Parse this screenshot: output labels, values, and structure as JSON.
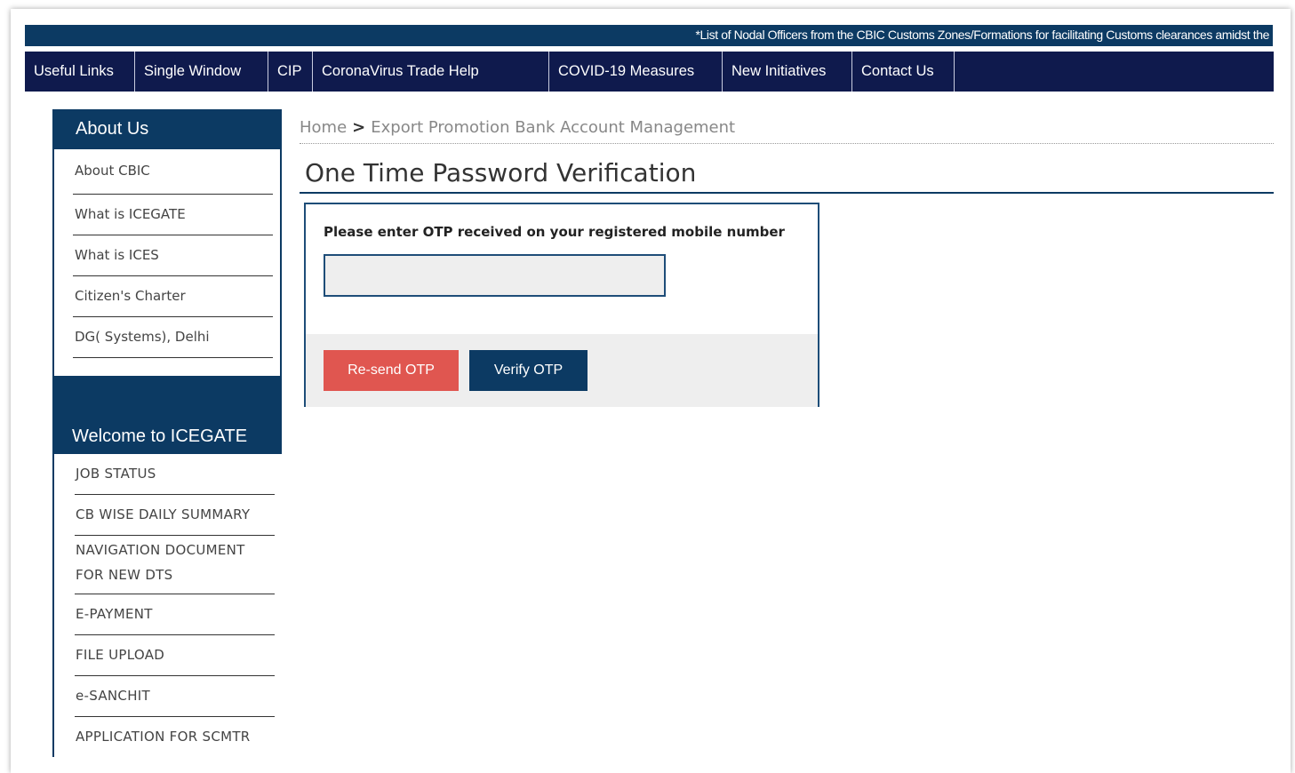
{
  "ticker": {
    "text": "*List of Nodal Officers from the CBIC Customs Zones/Formations for facilitating Customs clearances amidst the"
  },
  "menu": [
    {
      "label": "Useful Links"
    },
    {
      "label": "Single Window"
    },
    {
      "label": "CIP"
    },
    {
      "label": "CoronaVirus Trade Help"
    },
    {
      "label": "COVID-19 Measures"
    },
    {
      "label": "New Initiatives"
    },
    {
      "label": "Contact Us"
    }
  ],
  "about": {
    "title": "About Us",
    "items": [
      {
        "label": "About CBIC"
      },
      {
        "label": "What is ICEGATE"
      },
      {
        "label": "What is ICES"
      },
      {
        "label": "Citizen's Charter"
      },
      {
        "label": "DG( Systems), Delhi"
      }
    ]
  },
  "welcome": {
    "title": "Welcome to ICEGATE",
    "items": [
      {
        "label": "JOB STATUS"
      },
      {
        "label": "CB WISE DAILY SUMMARY"
      },
      {
        "label": "NAVIGATION DOCUMENT FOR NEW DTS"
      },
      {
        "label": "E-PAYMENT"
      },
      {
        "label": "FILE UPLOAD"
      },
      {
        "label": "e-SANCHIT"
      },
      {
        "label": "APPLICATION FOR SCMTR"
      }
    ]
  },
  "breadcrumb": {
    "home": "Home",
    "separator": ">",
    "current": "Export Promotion Bank Account Management"
  },
  "page": {
    "title": "One Time Password Verification"
  },
  "otp": {
    "label": "Please enter OTP received on your registered mobile number",
    "value": "",
    "resend_label": "Re-send OTP",
    "verify_label": "Verify OTP"
  },
  "colors": {
    "navy": "#0f1a4d",
    "blue": "#0c3a63",
    "resend_red": "#e05650"
  }
}
